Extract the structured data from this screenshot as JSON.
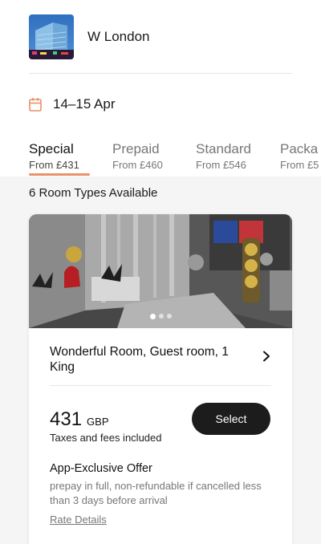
{
  "hotel": {
    "name": "W London",
    "thumbnail_icon": "hotel-building-photo"
  },
  "stay": {
    "dates": "14–15 Apr",
    "icon": "calendar-icon",
    "icon_color": "#e9916a"
  },
  "rate_tabs": [
    {
      "name": "Special",
      "price": "From £431",
      "active": true
    },
    {
      "name": "Prepaid",
      "price": "From £460",
      "active": false
    },
    {
      "name": "Standard",
      "price": "From £546",
      "active": false
    },
    {
      "name": "Packa",
      "price": "From £5",
      "active": false
    }
  ],
  "room_types_label": "6 Room Types Available",
  "room_card": {
    "title": "Wonderful Room, Guest room, 1 King",
    "image_icon": "room-interior-photo",
    "carousel_dots": 3,
    "carousel_active": 1,
    "price_amount": "431",
    "price_currency": "GBP",
    "taxes_note": "Taxes and fees included",
    "select_label": "Select",
    "offer_title": "App-Exclusive Offer",
    "offer_description": "prepay in full, non-refundable if cancelled less than 3 days before arrival",
    "rate_details_label": "Rate Details"
  },
  "colors": {
    "accent": "#e9916a",
    "button_dark": "#1c1c1c",
    "content_bg": "#f5f5f5"
  }
}
